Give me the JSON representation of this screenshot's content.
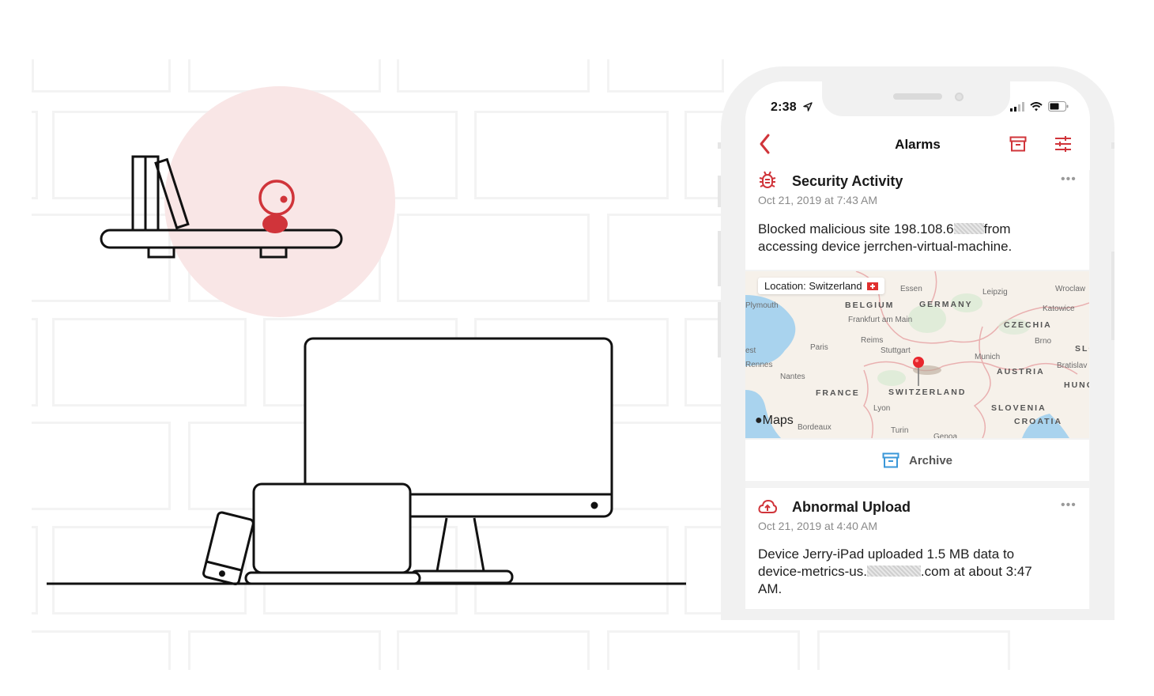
{
  "status_bar": {
    "time": "2:38",
    "location_arrow": "location-arrow-icon",
    "icons": [
      "signal-icon",
      "wifi-icon",
      "battery-icon"
    ]
  },
  "nav": {
    "back_icon": "chevron-left-icon",
    "title": "Alarms",
    "archive_icon": "archive-icon",
    "filter_icon": "sliders-icon"
  },
  "alarms": [
    {
      "icon": "bug-icon",
      "title": "Security Activity",
      "timestamp": "Oct 21, 2019 at 7:43 AM",
      "body_prefix": "Blocked malicious site 198.108.6",
      "body_suffix": "from",
      "body_line2": "accessing device jerrchen-virtual-machine.",
      "more": "•••",
      "location_label": "Location: Switzerland",
      "map": {
        "countries": [
          "BELGIUM",
          "GERMANY",
          "CZECHIA",
          "SLOVA",
          "AUSTRIA",
          "HUNG",
          "FRANCE",
          "SWITZERLAND",
          "SLOVENIA",
          "CROATIA"
        ],
        "cities": [
          "Essen",
          "Leipzig",
          "Wroclaw",
          "Katowice",
          "Frankfurt am Main",
          "Brno",
          "Reims",
          "Paris",
          "Stuttgart",
          "Munich",
          "Bratislav",
          "Rennes",
          "Nantes",
          "Lyon",
          "Bordeaux",
          "Turin",
          "Genoa",
          "Plymouth",
          "est"
        ],
        "attribution": "Maps"
      },
      "archive_label": "Archive"
    },
    {
      "icon": "cloud-upload-icon",
      "title": "Abnormal Upload",
      "timestamp": "Oct 21, 2019 at 4:40 AM",
      "body_line1": "Device Jerry-iPad uploaded 1.5 MB data to",
      "body_prefix2": "device-metrics-us.",
      "body_suffix2": ".com at about 3:47",
      "body_line3": "AM.",
      "more": "•••"
    }
  ],
  "colors": {
    "accent_red": "#d0343a",
    "archive_blue": "#3a97d8",
    "highlight_pink": "#f9e6e6"
  }
}
